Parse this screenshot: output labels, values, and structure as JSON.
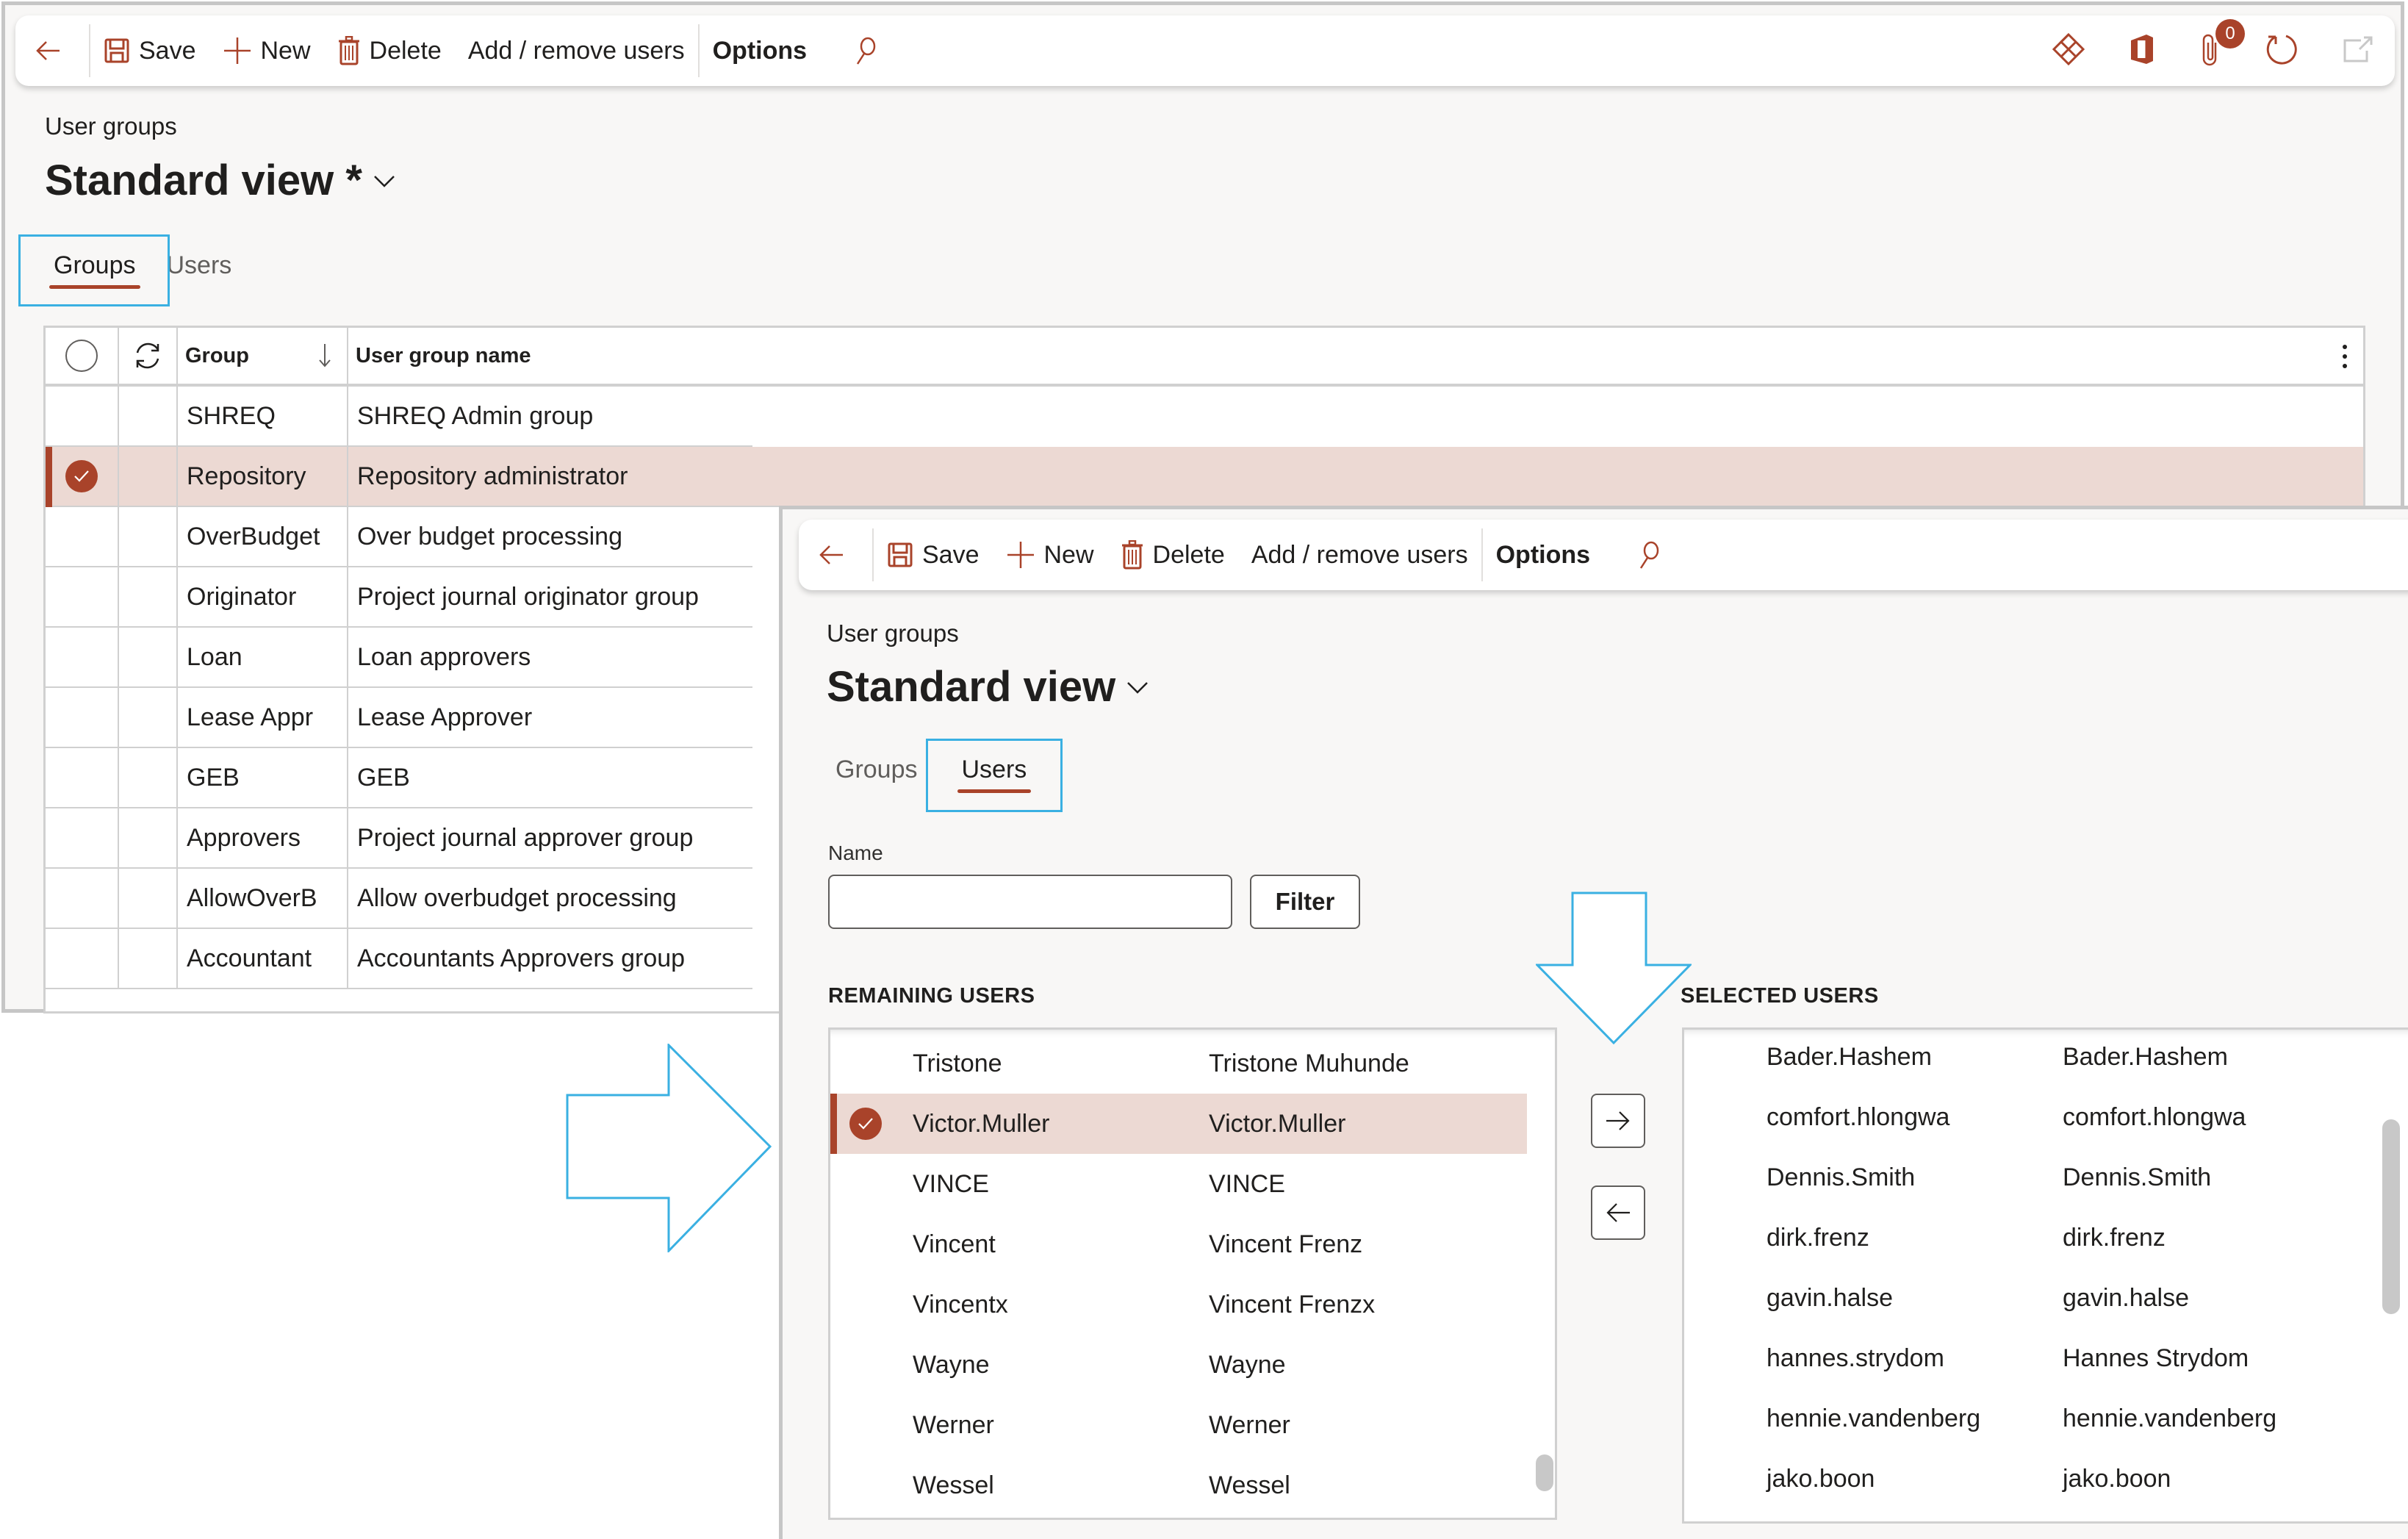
{
  "colors": {
    "accent": "#a9432a",
    "selected_row": "#ecd9d3",
    "annotation": "#3ab0e2"
  },
  "window_groups": {
    "toolbar": {
      "save": "Save",
      "new": "New",
      "delete": "Delete",
      "add_remove_users": "Add / remove users",
      "options": "Options",
      "attachments_count": "0",
      "icons": [
        "back-arrow-icon",
        "save-icon",
        "plus-icon",
        "trash-icon",
        "search-icon",
        "power-apps-icon",
        "office-icon",
        "attachment-icon",
        "refresh-icon",
        "open-in-new-window-icon"
      ]
    },
    "breadcrumb": "User groups",
    "view_title": "Standard view *",
    "tabs": [
      {
        "label": "Groups",
        "active": true
      },
      {
        "label": "Users",
        "active": false
      }
    ],
    "grid": {
      "columns": {
        "group": "Group",
        "name": "User group name"
      },
      "sort": "descending",
      "rows": [
        {
          "group": "SHREQ",
          "name": "SHREQ Admin group",
          "selected": false
        },
        {
          "group": "Repository",
          "name": "Repository administrator",
          "selected": true
        },
        {
          "group": "OverBudget",
          "name": "Over budget processing",
          "selected": false
        },
        {
          "group": "Originator",
          "name": "Project journal originator group",
          "selected": false
        },
        {
          "group": "Loan",
          "name": "Loan approvers",
          "selected": false
        },
        {
          "group": "Lease Appr",
          "name": "Lease Approver",
          "selected": false
        },
        {
          "group": "GEB",
          "name": "GEB",
          "selected": false
        },
        {
          "group": "Approvers",
          "name": "Project journal approver group",
          "selected": false
        },
        {
          "group": "AllowOverB",
          "name": "Allow overbudget processing",
          "selected": false
        },
        {
          "group": "Accountant",
          "name": "Accountants Approvers group",
          "selected": false
        }
      ]
    }
  },
  "window_users": {
    "toolbar": {
      "save": "Save",
      "new": "New",
      "delete": "Delete",
      "add_remove_users": "Add / remove users",
      "options": "Options"
    },
    "breadcrumb": "User groups",
    "view_title": "Standard view",
    "tabs": [
      {
        "label": "Groups",
        "active": false
      },
      {
        "label": "Users",
        "active": true
      }
    ],
    "filter": {
      "label": "Name",
      "value": "",
      "button": "Filter"
    },
    "remaining_title": "REMAINING USERS",
    "selected_title": "SELECTED USERS",
    "remaining_users": [
      {
        "id": "Tristone",
        "name": "Tristone Muhunde",
        "selected": false
      },
      {
        "id": "Victor.Muller",
        "name": "Victor.Muller",
        "selected": true
      },
      {
        "id": "VINCE",
        "name": "VINCE",
        "selected": false
      },
      {
        "id": "Vincent",
        "name": "Vincent Frenz",
        "selected": false
      },
      {
        "id": "Vincentx",
        "name": "Vincent Frenzx",
        "selected": false
      },
      {
        "id": "Wayne",
        "name": "Wayne",
        "selected": false
      },
      {
        "id": "Werner",
        "name": "Werner",
        "selected": false
      },
      {
        "id": "Wessel",
        "name": "Wessel",
        "selected": false
      }
    ],
    "selected_users": [
      {
        "id": "Bader.Hashem",
        "name": "Bader.Hashem"
      },
      {
        "id": "comfort.hlongwa",
        "name": "comfort.hlongwa"
      },
      {
        "id": "Dennis.Smith",
        "name": "Dennis.Smith"
      },
      {
        "id": "dirk.frenz",
        "name": "dirk.frenz"
      },
      {
        "id": "gavin.halse",
        "name": "gavin.halse"
      },
      {
        "id": "hannes.strydom",
        "name": "Hannes Strydom"
      },
      {
        "id": "hennie.vandenberg",
        "name": "hennie.vandenberg"
      },
      {
        "id": "jako.boon",
        "name": "jako.boon"
      }
    ],
    "move_buttons": [
      "move-right-arrow-icon",
      "move-left-arrow-icon"
    ]
  }
}
